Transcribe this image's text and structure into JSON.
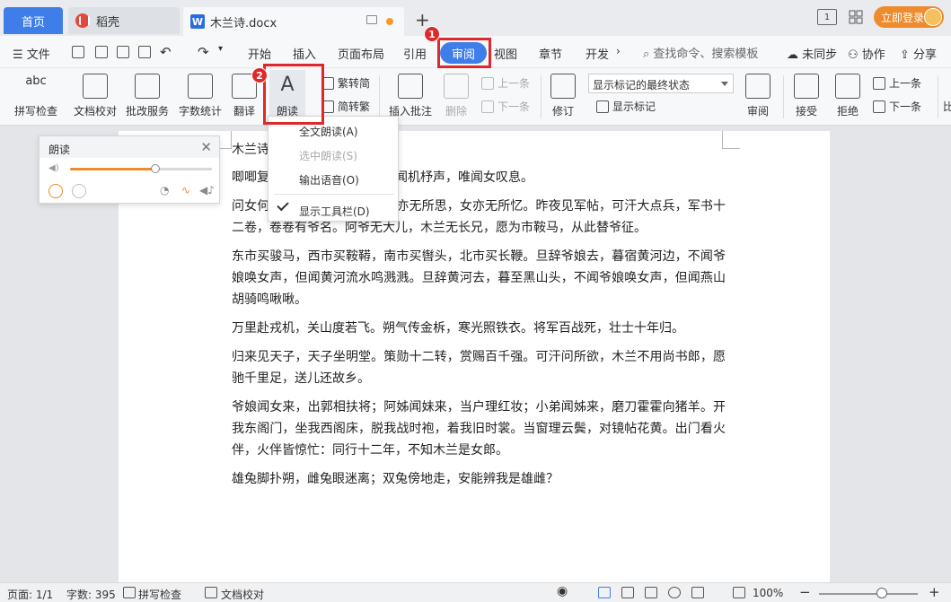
{
  "titlebar": {
    "tab_home": "首页",
    "tab_daoke": "稻壳",
    "tab_doc": "木兰诗.docx",
    "tab_doc_icon": "W",
    "add_tab": "+",
    "login_label": "立即登录",
    "layout_icon_label": "1"
  },
  "menubar": {
    "file": "文件",
    "items": [
      "开始",
      "插入",
      "页面布局",
      "引用",
      "审阅",
      "视图",
      "章节",
      "开发"
    ],
    "active": "审阅",
    "search_placeholder": "查找命令、搜索模板",
    "unsync": "未同步",
    "collab": "协作",
    "share": "分享"
  },
  "annotations": {
    "badge1": "1",
    "badge2": "2"
  },
  "ribbon": {
    "spellcheck": "拼写检查",
    "doc_check": "文档校对",
    "correction": "批改服务",
    "word_count": "字数统计",
    "translate": "翻译",
    "read_aloud": "朗读",
    "to_traditional": "繁转简",
    "to_simplified": "简转繁",
    "insert_comment": "插入批注",
    "delete": "删除",
    "prev_comment": "上一条",
    "next_comment": "下一条",
    "revise": "修订",
    "display_status": "显示标记的最终状态",
    "show_markup": "显示标记",
    "review": "审阅",
    "accept": "接受",
    "reject": "拒绝",
    "prev": "上一条",
    "next": "下一条",
    "compare": "比"
  },
  "dropdown": {
    "items": [
      {
        "label": "全文朗读(A)",
        "enabled": true
      },
      {
        "label": "选中朗读(S)",
        "enabled": false
      },
      {
        "label": "输出语音(O)",
        "enabled": true
      },
      {
        "label": "显示工具栏(D)",
        "enabled": true,
        "checked": true
      }
    ]
  },
  "read_panel": {
    "title": "朗读",
    "close": "✕",
    "volume_fraction": 0.6
  },
  "document": {
    "title": "木兰诗",
    "paragraphs": [
      "唧唧复唧唧，木兰当户织。不闻机杼声，唯闻女叹息。",
      "问女何所思，问女何所忆。女亦无所思，女亦无所忆。昨夜见军帖，可汗大点兵，军书十二卷，卷卷有爷名。阿爷无大儿，木兰无长兄，愿为市鞍马，从此替爷征。",
      "东市买骏马，西市买鞍鞯，南市买辔头，北市买长鞭。旦辞爷娘去，暮宿黄河边，不闻爷娘唤女声，但闻黄河流水鸣溅溅。旦辞黄河去，暮至黑山头，不闻爷娘唤女声，但闻燕山胡骑鸣啾啾。",
      "万里赴戎机，关山度若飞。朔气传金柝，寒光照铁衣。将军百战死，壮士十年归。",
      "归来见天子，天子坐明堂。策勋十二转，赏赐百千强。可汗问所欲，木兰不用尚书郎，愿驰千里足，送儿还故乡。",
      "爷娘闻女来，出郭相扶将；阿姊闻妹来，当户理红妆；小弟闻姊来，磨刀霍霍向猪羊。开我东阁门，坐我西阁床，脱我战时袍，着我旧时裳。当窗理云鬓，对镜帖花黄。出门看火伴，火伴皆惊忙：同行十二年，不知木兰是女郎。",
      "雄兔脚扑朔，雌兔眼迷离；双兔傍地走，安能辨我是雄雌？"
    ]
  },
  "statusbar": {
    "page": "页面: 1/1",
    "words": "字数: 395",
    "spellcheck": "拼写检查",
    "doc_check": "文档校对",
    "zoom": "100%",
    "minus": "−",
    "plus": "+"
  },
  "colors": {
    "accent": "#3f7ee8",
    "highlight": "#e0282a",
    "login": "#ee8b2c"
  }
}
